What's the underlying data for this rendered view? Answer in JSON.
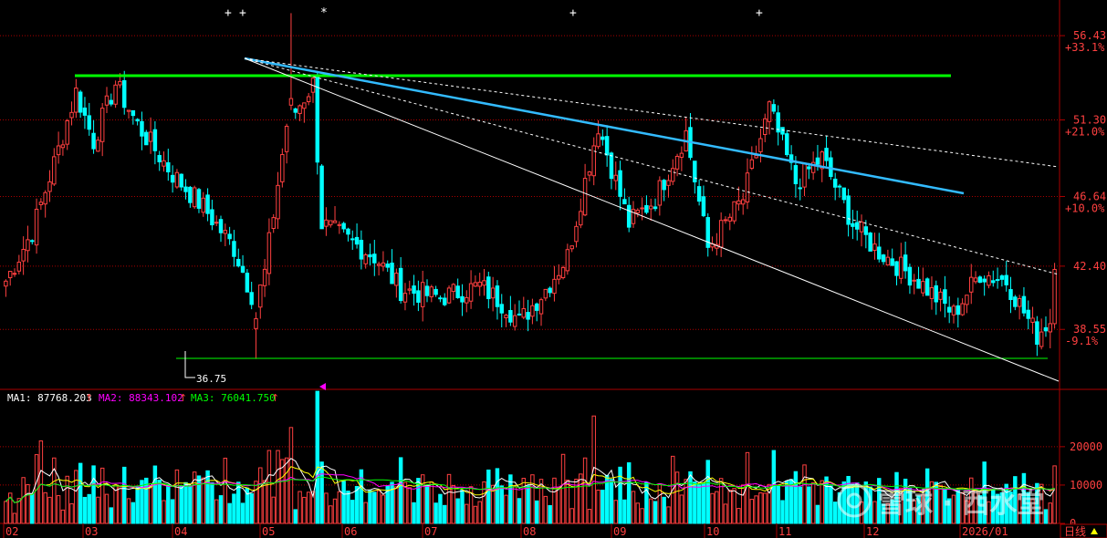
{
  "chart_data": {
    "type": "candlestick",
    "price_axis": {
      "ticks": [
        {
          "value": 56.43,
          "label": "56.43",
          "pct": "+33.1%"
        },
        {
          "value": 51.3,
          "label": "51.30",
          "pct": "+21.0%"
        },
        {
          "value": 46.64,
          "label": "46.64",
          "pct": "+10.0%"
        },
        {
          "value": 42.4,
          "label": "42.40",
          "pct": ""
        },
        {
          "value": 38.55,
          "label": "38.55",
          "pct": "-9.1%"
        }
      ],
      "range": [
        34.9,
        58.6
      ]
    },
    "low_marker": "36.75",
    "month_labels": [
      "02",
      "03",
      "04",
      "05",
      "06",
      "07",
      "08",
      "09",
      "10",
      "11",
      "12",
      "2026/01"
    ],
    "period_label": "日线",
    "volume": {
      "ma_line": {
        "prefix": "",
        "ma1": "MA1: 87768.203",
        "ma2": "MA2: 88343.102",
        "ma3": "MA3: 76041.750"
      },
      "axis_ticks": [
        {
          "value": 20000,
          "label": "20000"
        },
        {
          "value": 10000,
          "label": "10000"
        },
        {
          "value": 0,
          "label": "0"
        }
      ],
      "range": [
        0,
        29000
      ]
    },
    "levels": [
      {
        "name": "resistance",
        "value": 55.4,
        "color": "#00ff00"
      },
      {
        "name": "support",
        "value": 36.9,
        "color": "#00ff00"
      }
    ],
    "colors": {
      "up": "#ff4040",
      "down": "#00ffff",
      "ma1": "#ffffff",
      "ma2": "#ff00ff",
      "ma3": "#00ff00",
      "ma_yellow": "#ffff00",
      "trend_blue": "#33bbff",
      "axis": "#aa0000"
    },
    "watermark": "雪球 · 西水堂"
  }
}
